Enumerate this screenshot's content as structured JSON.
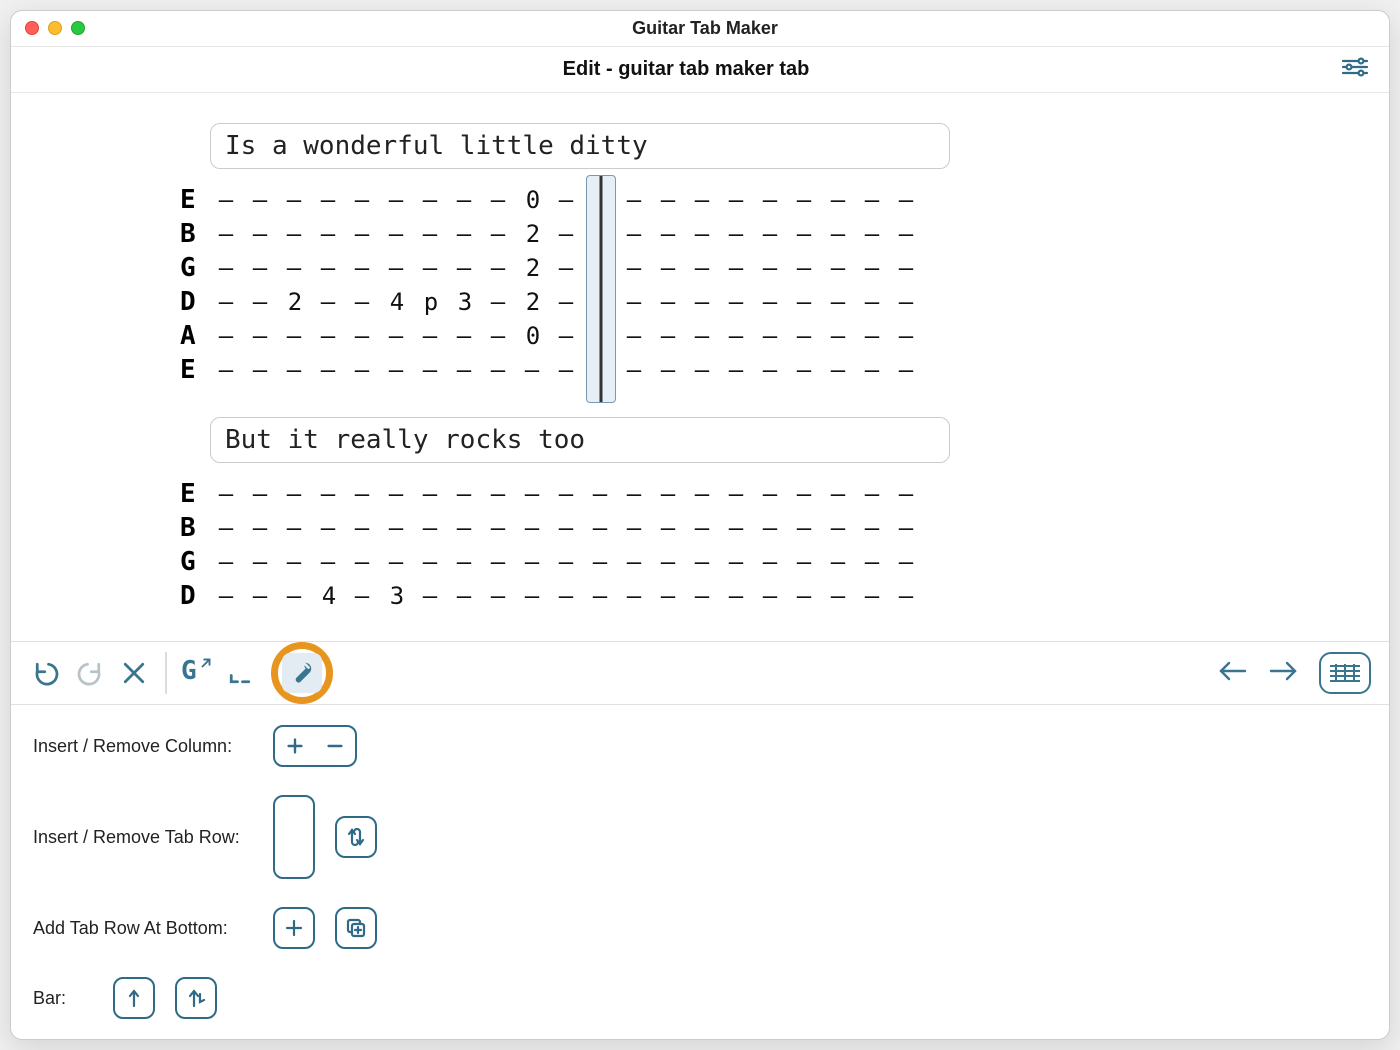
{
  "app": {
    "title": "Guitar Tab Maker"
  },
  "header": {
    "title": "Edit - guitar tab maker tab"
  },
  "tab": {
    "strings": [
      "E",
      "B",
      "G",
      "D",
      "A",
      "E"
    ],
    "columns": 21,
    "cursor_col": 11,
    "blocks": [
      {
        "lyric": "Is a wonderful little ditty",
        "show_cursor": true,
        "cells": {
          "E_hi": {
            "9": "0"
          },
          "B": {
            "9": "2"
          },
          "G": {
            "9": "2"
          },
          "D": {
            "2": "2",
            "5": "4",
            "6": "p",
            "7": "3",
            "9": "2"
          },
          "A": {
            "9": "0"
          },
          "E_lo": {}
        }
      },
      {
        "lyric": "But it really rocks too",
        "show_cursor": false,
        "truncate_after_string": 3,
        "cells": {
          "E_hi": {},
          "B": {},
          "G": {},
          "D": {
            "3": "4",
            "5": "3"
          },
          "A": {},
          "E_lo": {}
        }
      }
    ]
  },
  "toolbar": {
    "undo": "undo",
    "redo": "redo",
    "cancel": "cancel",
    "export": "G↗",
    "crop": "crop",
    "tools": "tools"
  },
  "tools": {
    "insert_remove_column": "Insert / Remove Column:",
    "insert_remove_row": "Insert / Remove Tab Row:",
    "add_row_bottom": "Add Tab Row At Bottom:",
    "bar": "Bar:"
  }
}
